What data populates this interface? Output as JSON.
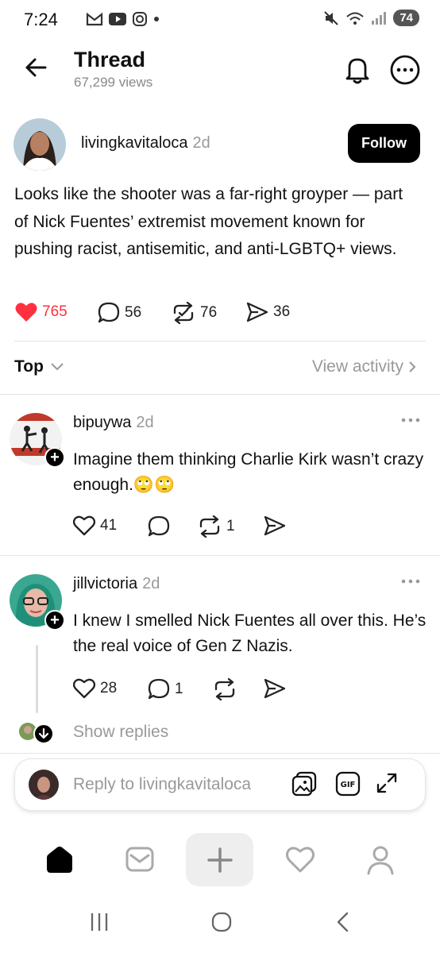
{
  "status_bar": {
    "time": "7:24",
    "battery": "74"
  },
  "header": {
    "title": "Thread",
    "views": "67,299 views"
  },
  "post": {
    "username": "livingkavitaloca",
    "time": "2d",
    "follow_label": "Follow",
    "text": "Looks like the shooter was a far-right groyper — part of Nick Fuentes’ extremist movement known for pushing racist, antisemitic, and anti-LGBTQ+ views.",
    "likes": "765",
    "comments": "56",
    "reposts": "76",
    "shares": "36",
    "like_color": "#ff3040"
  },
  "sort": {
    "label": "Top",
    "view_activity": "View activity"
  },
  "replies": [
    {
      "username": "bipuywa",
      "time": "2d",
      "text": "Imagine them thinking Charlie Kirk wasn’t crazy enough.🙄🙄",
      "likes": "41",
      "comments": "",
      "reposts": "1"
    },
    {
      "username": "jillvictoria",
      "time": "2d",
      "text": "I knew I smelled Nick Fuentes all over this. He’s the real voice of Gen Z Nazis.",
      "likes": "28",
      "comments": "1",
      "reposts": ""
    }
  ],
  "show_replies": "Show replies",
  "reply_bar": {
    "placeholder": "Reply to livingkavitaloca"
  },
  "nav": {
    "items": [
      "home-icon",
      "inbox-icon",
      "create-icon",
      "activity-icon",
      "profile-icon"
    ]
  }
}
